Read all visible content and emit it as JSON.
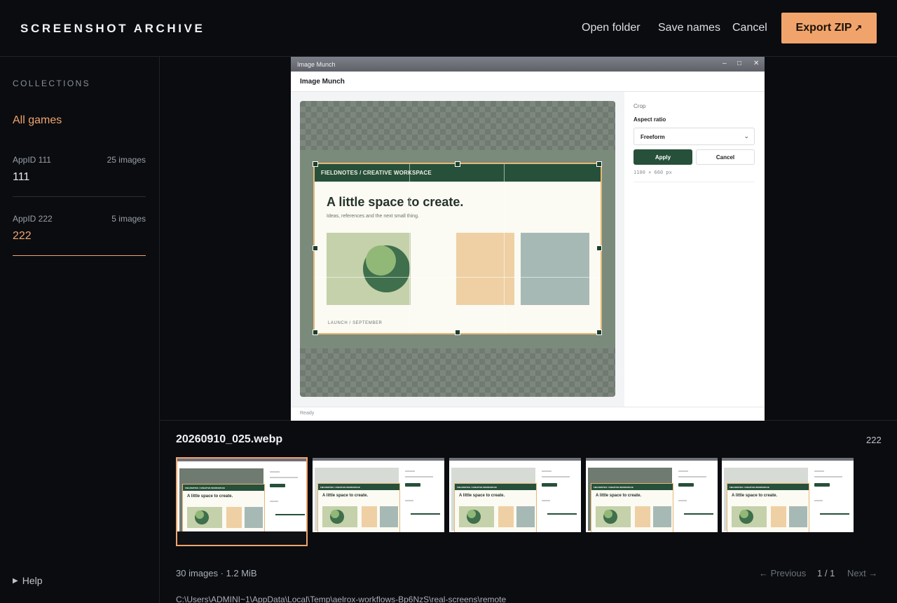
{
  "header": {
    "brand": "SCREENSHOT ARCHIVE",
    "open_folder": "Open folder",
    "save_names": "Save names",
    "cancel": "Cancel",
    "export": "Export ZIP",
    "export_icon": "↗"
  },
  "sidebar": {
    "title": "COLLECTIONS",
    "all_label": "All games",
    "items": [
      {
        "appid": "AppID 111",
        "count": "25 images",
        "name": "111"
      },
      {
        "appid": "AppID 222",
        "count": "5 images",
        "name": "222"
      }
    ],
    "help": "Help",
    "help_icon": "▶"
  },
  "preview": {
    "window_title": "Image Munch",
    "window_controls": {
      "minimize": "–",
      "maximize": "□",
      "close": "✕"
    },
    "app_header": "Image Munch",
    "status": "Ready",
    "image": {
      "bar_text": "FIELDNOTES / CREATIVE WORKSPACE",
      "headline": "A little space to create.",
      "subline": "Ideas, references and the next small thing.",
      "footer": "LAUNCH / SEPTEMBER"
    },
    "panel": {
      "section": "Crop",
      "aspect_label": "Aspect ratio",
      "aspect_value": "Freeform",
      "apply": "Apply",
      "cancel": "Cancel",
      "dimensions": "1100 × 660 px"
    }
  },
  "filmstrip": {
    "file_name": "20260910_025.webp",
    "collection_id": "222",
    "thumb_headline": "A little space to create.",
    "thumb_bar": "FIELDNOTES / CREATIVE WORKSPACE",
    "selected_index": 0
  },
  "footer": {
    "stats": "30 images · 1.2 MiB",
    "previous": "← Previous",
    "position": "1 / 1",
    "next": "Next →",
    "path": "C:\\Users\\ADMINI~1\\AppData\\Local\\Temp\\aelrox-workflows-Bp6NzS\\real-screens\\remote"
  },
  "colors": {
    "accent": "#f0a46c",
    "brand_green": "#26503a",
    "background": "#0a0c10"
  }
}
